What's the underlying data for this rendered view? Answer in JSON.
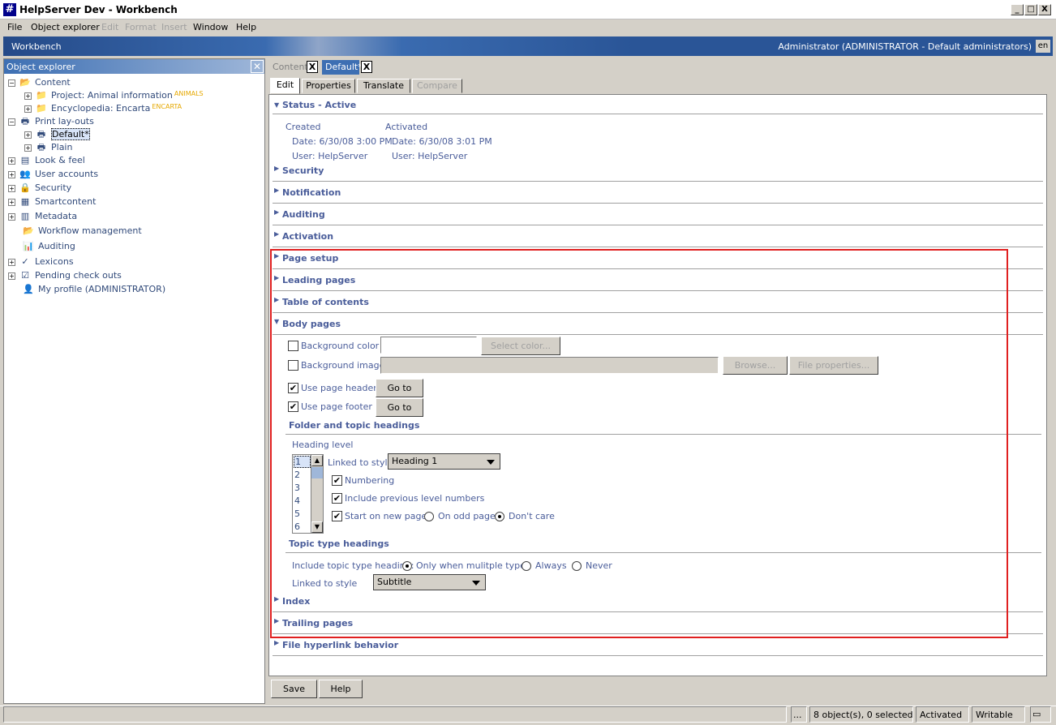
{
  "window": {
    "title": "HelpServer Dev - Workbench",
    "minimize": "_",
    "maximize": "□",
    "close": "X"
  },
  "menu": [
    "File",
    "Object explorer",
    "Edit",
    "Format",
    "Insert",
    "Window",
    "Help"
  ],
  "workbench": {
    "title": "Workbench",
    "user": "Administrator (ADMINISTRATOR - Default administrators)",
    "lang": "en"
  },
  "explorer": {
    "title": "Object explorer",
    "items": [
      {
        "label": "Content"
      },
      {
        "label": "Project: Animal information",
        "tag": "ANIMALS"
      },
      {
        "label": "Encyclopedia: Encarta",
        "tag": "ENCARTA"
      },
      {
        "label": "Print lay-outs"
      },
      {
        "label": "Default*"
      },
      {
        "label": "Plain"
      },
      {
        "label": "Look & feel"
      },
      {
        "label": "User accounts"
      },
      {
        "label": "Security"
      },
      {
        "label": "Smartcontent"
      },
      {
        "label": "Metadata"
      },
      {
        "label": "Workflow management"
      },
      {
        "label": "Auditing"
      },
      {
        "label": "Lexicons"
      },
      {
        "label": "Pending check outs"
      },
      {
        "label": "My profile (ADMINISTRATOR)"
      }
    ]
  },
  "doc_tabs": {
    "content": "Content",
    "default": "Default*",
    "close": "X"
  },
  "sub_tabs": [
    "Edit",
    "Properties",
    "Translate",
    "Compare"
  ],
  "status": {
    "heading": "Status - Active",
    "created": "Created",
    "activated": "Activated",
    "created_date": "Date:  6/30/08 3:00 PM",
    "activated_date": "Date:  6/30/08 3:01 PM",
    "created_user": "User:  HelpServer",
    "activated_user": "User:  HelpServer"
  },
  "sections": {
    "security": "Security",
    "notification": "Notification",
    "auditing": "Auditing",
    "activation": "Activation",
    "page_setup": "Page setup",
    "leading_pages": "Leading pages",
    "toc": "Table of contents",
    "body_pages": "Body pages",
    "index": "Index",
    "trailing_pages": "Trailing pages",
    "file_hyperlink": "File hyperlink behavior"
  },
  "body": {
    "bg_color": "Background color",
    "select_color": "Select color...",
    "bg_image": "Background image",
    "browse": "Browse...",
    "file_props": "File properties...",
    "use_header": "Use page header",
    "use_footer": "Use page footer",
    "goto": "Go to",
    "folder_headings": "Folder and topic headings",
    "heading_level": "Heading level",
    "levels": [
      "1",
      "2",
      "3",
      "4",
      "5",
      "6"
    ],
    "linked_to_style": "Linked to style",
    "style_value": "Heading 1",
    "numbering": "Numbering",
    "include_prev": "Include previous level numbers",
    "start_new_page": "Start on new page",
    "on_odd_page": "On odd page",
    "dont_care": "Don't care",
    "topic_type_headings": "Topic type headings",
    "include_topic": "Include topic type heading:",
    "only_multiple": "Only when mulitple types",
    "always": "Always",
    "never": "Never",
    "linked_to_style2": "Linked to style",
    "style_value2": "Subtitle"
  },
  "buttons": {
    "save": "Save",
    "help": "Help"
  },
  "statusbar": {
    "ellipsis": "...",
    "objects": "8 object(s), 0 selected",
    "activated": "Activated",
    "writable": "Writable"
  },
  "colors": {
    "accent": "#4a5d9a",
    "highlight_box": "#e02020",
    "title_bar": "#254a88"
  }
}
